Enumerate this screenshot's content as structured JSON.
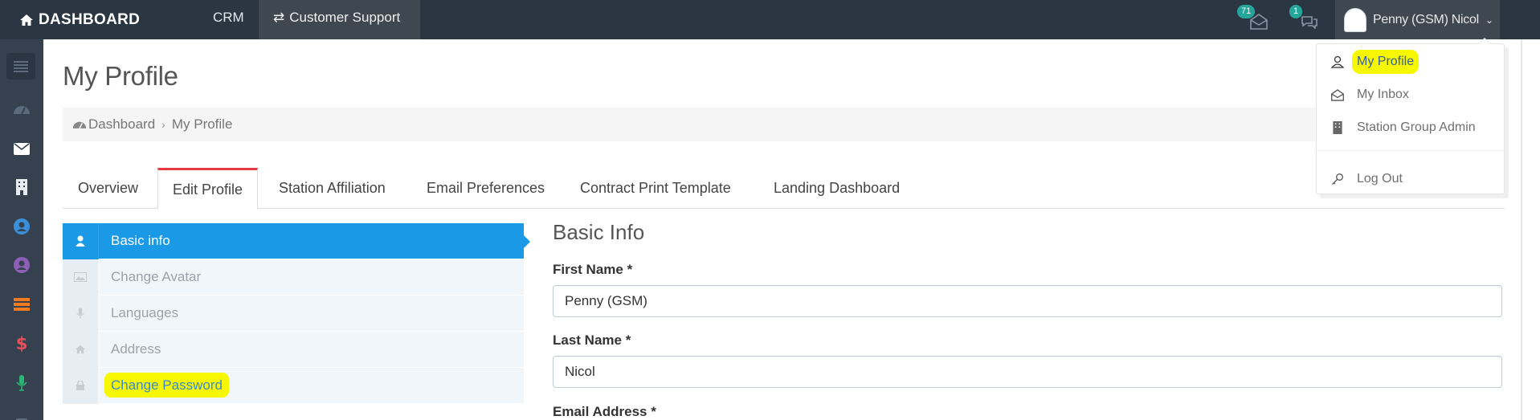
{
  "topbar": {
    "brand": "DASHBOARD",
    "nav_crm": "CRM",
    "nav_customer_support": "Customer Support",
    "mail_badge": "71",
    "chat_badge": "1",
    "user_name": "Penny (GSM) Nicol"
  },
  "page": {
    "title": "My Profile",
    "breadcrumb": [
      "Dashboard",
      "My Profile"
    ]
  },
  "tabs": [
    "Overview",
    "Edit Profile",
    "Station Affiliation",
    "Email Preferences",
    "Contract Print Template",
    "Landing Dashboard"
  ],
  "active_tab": "Edit Profile",
  "side_menu": [
    "Basic info",
    "Change Avatar",
    "Languages",
    "Address",
    "Change Password"
  ],
  "form": {
    "title": "Basic Info",
    "first_name_label": "First Name *",
    "first_name_value": "Penny (GSM)",
    "last_name_label": "Last Name *",
    "last_name_value": "Nicol",
    "email_label": "Email Address *"
  },
  "user_menu": [
    "My Profile",
    "My Inbox",
    "Station Group Admin",
    "Log Out"
  ],
  "colors": {
    "topbar": "#2b3643",
    "rail": "#364150",
    "active_blue": "#1a9ae6",
    "badge_teal": "#26a69a",
    "tab_red": "#e43a45",
    "highlight": "#f7f700"
  }
}
